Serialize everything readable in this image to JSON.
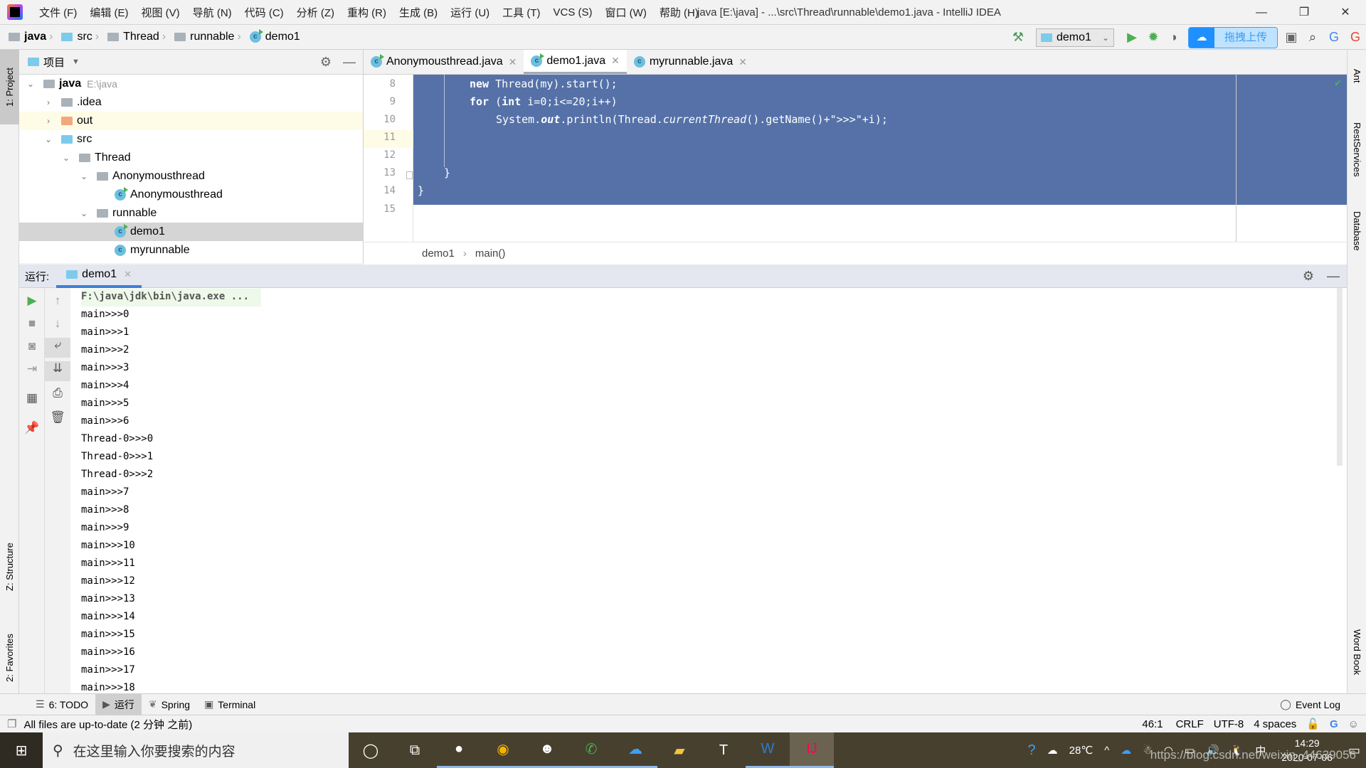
{
  "window": {
    "title": "java [E:\\java] - ...\\src\\Thread\\runnable\\demo1.java - IntelliJ IDEA",
    "menu": [
      "文件 (F)",
      "编辑 (E)",
      "视图 (V)",
      "导航 (N)",
      "代码 (C)",
      "分析 (Z)",
      "重构 (R)",
      "生成 (B)",
      "运行 (U)",
      "工具 (T)",
      "VCS (S)",
      "窗口 (W)",
      "帮助 (H)"
    ],
    "controls": {
      "minimize": "—",
      "maximize": "❐",
      "close": "✕"
    }
  },
  "navbar": {
    "breadcrumbs": [
      "java",
      "src",
      "Thread",
      "runnable",
      "demo1"
    ],
    "run_config": "demo1",
    "upload_label": "拖拽上传"
  },
  "left_stripe": {
    "project": "1: Project",
    "structure": "Z: Structure",
    "favorites": "2: Favorites"
  },
  "right_stripe": {
    "ant": "Ant",
    "rest": "RestServices",
    "database": "Database",
    "wordbook": "Word Book"
  },
  "project": {
    "title": "项目",
    "tree": [
      {
        "label": "java",
        "hint": "E:\\java",
        "depth": 0,
        "expanded": true,
        "icon": "module"
      },
      {
        "label": ".idea",
        "depth": 1,
        "expanded": false,
        "icon": "folder"
      },
      {
        "label": "out",
        "depth": 1,
        "expanded": false,
        "icon": "folder-excluded"
      },
      {
        "label": "src",
        "depth": 1,
        "expanded": true,
        "icon": "source-folder"
      },
      {
        "label": "Thread",
        "depth": 2,
        "expanded": true,
        "icon": "package"
      },
      {
        "label": "Anonymousthread",
        "depth": 3,
        "expanded": true,
        "icon": "package"
      },
      {
        "label": "Anonymousthread",
        "depth": 4,
        "icon": "class-runnable"
      },
      {
        "label": "runnable",
        "depth": 3,
        "expanded": true,
        "icon": "package"
      },
      {
        "label": "demo1",
        "depth": 4,
        "icon": "class-runnable",
        "selected": true
      },
      {
        "label": "myrunnable",
        "depth": 4,
        "icon": "class"
      }
    ]
  },
  "editor": {
    "tabs": [
      {
        "label": "Anonymousthread.java",
        "active": false
      },
      {
        "label": "demo1.java",
        "active": true
      },
      {
        "label": "myrunnable.java",
        "active": false
      }
    ],
    "line_numbers": [
      "8",
      "9",
      "10",
      "11",
      "12",
      "13",
      "14",
      "15"
    ],
    "code": {
      "l8_kw": "new",
      "l8_rest": " Thread(my).start();",
      "l9_kw1": "for",
      "l9_mid": " (",
      "l9_kw2": "int",
      "l9_rest": " i=0;i<=20;i++)",
      "l10_a": "System.",
      "l10_out": "out",
      "l10_b": ".println(Thread.",
      "l10_ct": "currentThread",
      "l10_c": "().getName()+\">>>\"+i);",
      "l13": "}",
      "l14": "}"
    },
    "breadcrumb": [
      "demo1",
      "main()"
    ]
  },
  "run": {
    "label": "运行:",
    "tab": "demo1",
    "console": [
      "F:\\java\\jdk\\bin\\java.exe ...",
      "main>>>0",
      "main>>>1",
      "main>>>2",
      "main>>>3",
      "main>>>4",
      "main>>>5",
      "main>>>6",
      "Thread-0>>>0",
      "Thread-0>>>1",
      "Thread-0>>>2",
      "main>>>7",
      "main>>>8",
      "main>>>9",
      "main>>>10",
      "main>>>11",
      "main>>>12",
      "main>>>13",
      "main>>>14",
      "main>>>15",
      "main>>>16",
      "main>>>17",
      "main>>>18"
    ]
  },
  "bottom_tabs": [
    "6: TODO",
    "运行",
    "Spring",
    "Terminal"
  ],
  "event_log": "Event Log",
  "status": {
    "message": "All files are up-to-date (2 分钟 之前)",
    "position": "46:1",
    "line_sep": "CRLF",
    "encoding": "UTF-8",
    "indent": "4 spaces"
  },
  "taskbar": {
    "search_placeholder": "在这里输入你要搜索的内容",
    "apps": [
      "cortana",
      "task-view",
      "steam",
      "chrome",
      "game",
      "wechat",
      "baidu-netdisk",
      "file-explorer",
      "typora",
      "word",
      "intellij"
    ],
    "temperature": "28℃",
    "ime": "中",
    "time": "14:29",
    "date": "2020-07-06",
    "watermark": "https://blog.csdn.net/weixin_44639056"
  },
  "colors": {
    "selection": "#5571a8",
    "run_accent": "#3d7fd6",
    "taskbar": "#47402f"
  }
}
